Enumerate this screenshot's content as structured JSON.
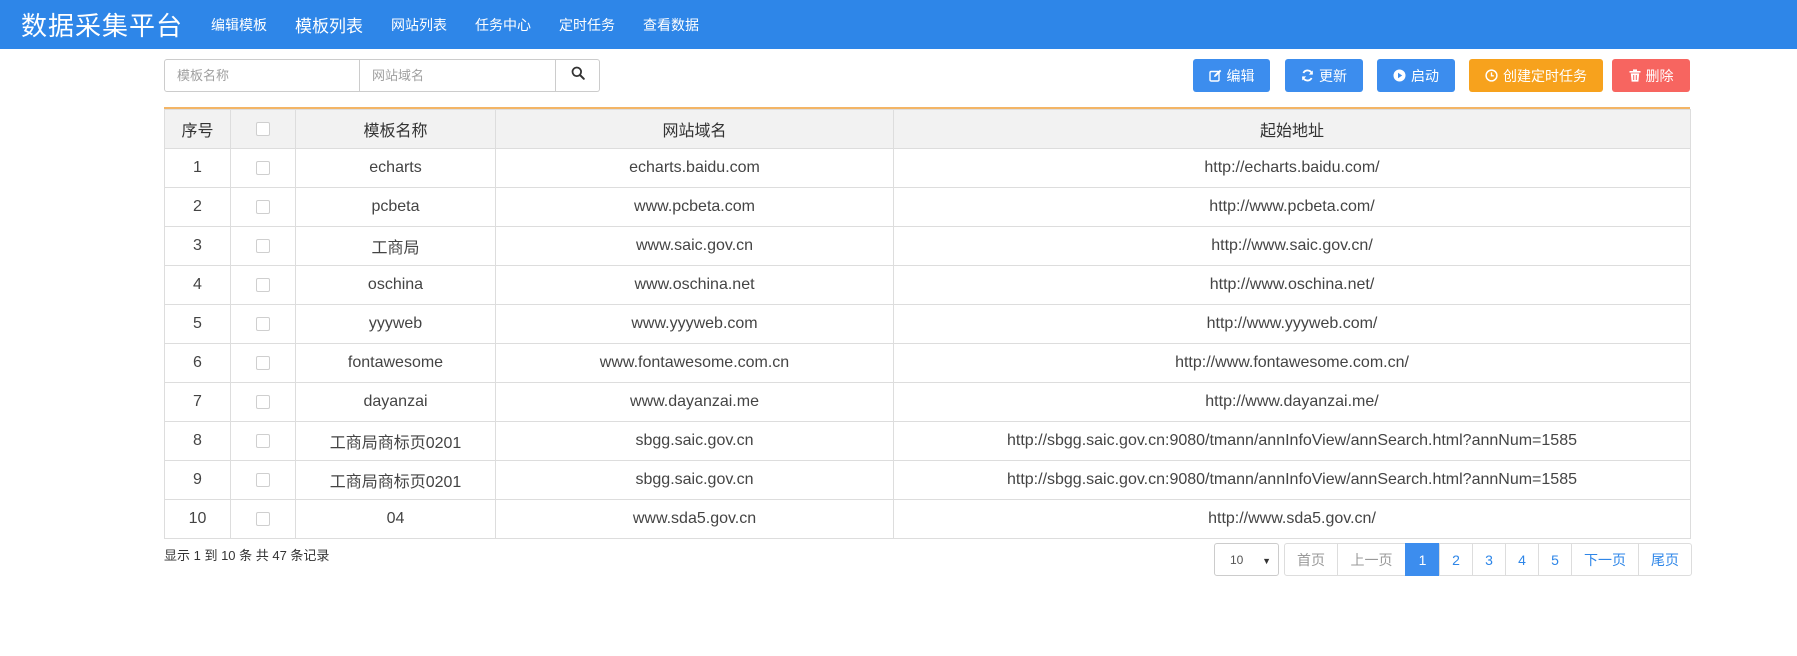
{
  "brand": "数据采集平台",
  "nav": [
    {
      "label": "编辑模板"
    },
    {
      "label": "模板列表"
    },
    {
      "label": "网站列表"
    },
    {
      "label": "任务中心"
    },
    {
      "label": "定时任务"
    },
    {
      "label": "查看数据"
    }
  ],
  "search": {
    "template_placeholder": "模板名称",
    "site_placeholder": "网站域名"
  },
  "actions": {
    "edit": "编辑",
    "update": "更新",
    "start": "启动",
    "schedule": "创建定时任务",
    "delete": "删除"
  },
  "table": {
    "headers": {
      "index": "序号",
      "name": "模板名称",
      "domain": "网站域名",
      "url": "起始地址"
    },
    "rows": [
      {
        "index": "1",
        "name": "echarts",
        "domain": "echarts.baidu.com",
        "url": "http://echarts.baidu.com/"
      },
      {
        "index": "2",
        "name": "pcbeta",
        "domain": "www.pcbeta.com",
        "url": "http://www.pcbeta.com/"
      },
      {
        "index": "3",
        "name": "工商局",
        "domain": "www.saic.gov.cn",
        "url": "http://www.saic.gov.cn/"
      },
      {
        "index": "4",
        "name": "oschina",
        "domain": "www.oschina.net",
        "url": "http://www.oschina.net/"
      },
      {
        "index": "5",
        "name": "yyyweb",
        "domain": "www.yyyweb.com",
        "url": "http://www.yyyweb.com/"
      },
      {
        "index": "6",
        "name": "fontawesome",
        "domain": "www.fontawesome.com.cn",
        "url": "http://www.fontawesome.com.cn/"
      },
      {
        "index": "7",
        "name": "dayanzai",
        "domain": "www.dayanzai.me",
        "url": "http://www.dayanzai.me/"
      },
      {
        "index": "8",
        "name": "工商局商标页0201",
        "domain": "sbgg.saic.gov.cn",
        "url": "http://sbgg.saic.gov.cn:9080/tmann/annInfoView/annSearch.html?annNum=1585"
      },
      {
        "index": "9",
        "name": "工商局商标页0201",
        "domain": "sbgg.saic.gov.cn",
        "url": "http://sbgg.saic.gov.cn:9080/tmann/annInfoView/annSearch.html?annNum=1585"
      },
      {
        "index": "10",
        "name": "04",
        "domain": "www.sda5.gov.cn",
        "url": "http://www.sda5.gov.cn/"
      }
    ]
  },
  "footer": {
    "summary": "显示 1 到 10 条 共 47 条记录",
    "page_size": "10",
    "pagination": {
      "first": "首页",
      "prev": "上一页",
      "pages": [
        "1",
        "2",
        "3",
        "4",
        "5"
      ],
      "active_page": "1",
      "next": "下一页",
      "last": "尾页"
    }
  },
  "colors": {
    "navbar": "#2e86e8",
    "primary_button": "#3c8dee",
    "warning_button": "#f7a21d",
    "danger_button": "#f76560",
    "table_top_border": "#f3b566"
  },
  "icons": {
    "edit": "edit-icon",
    "update": "refresh-icon",
    "start": "play-circle-icon",
    "schedule": "clock-icon",
    "delete": "trash-icon",
    "search": "search-icon"
  }
}
